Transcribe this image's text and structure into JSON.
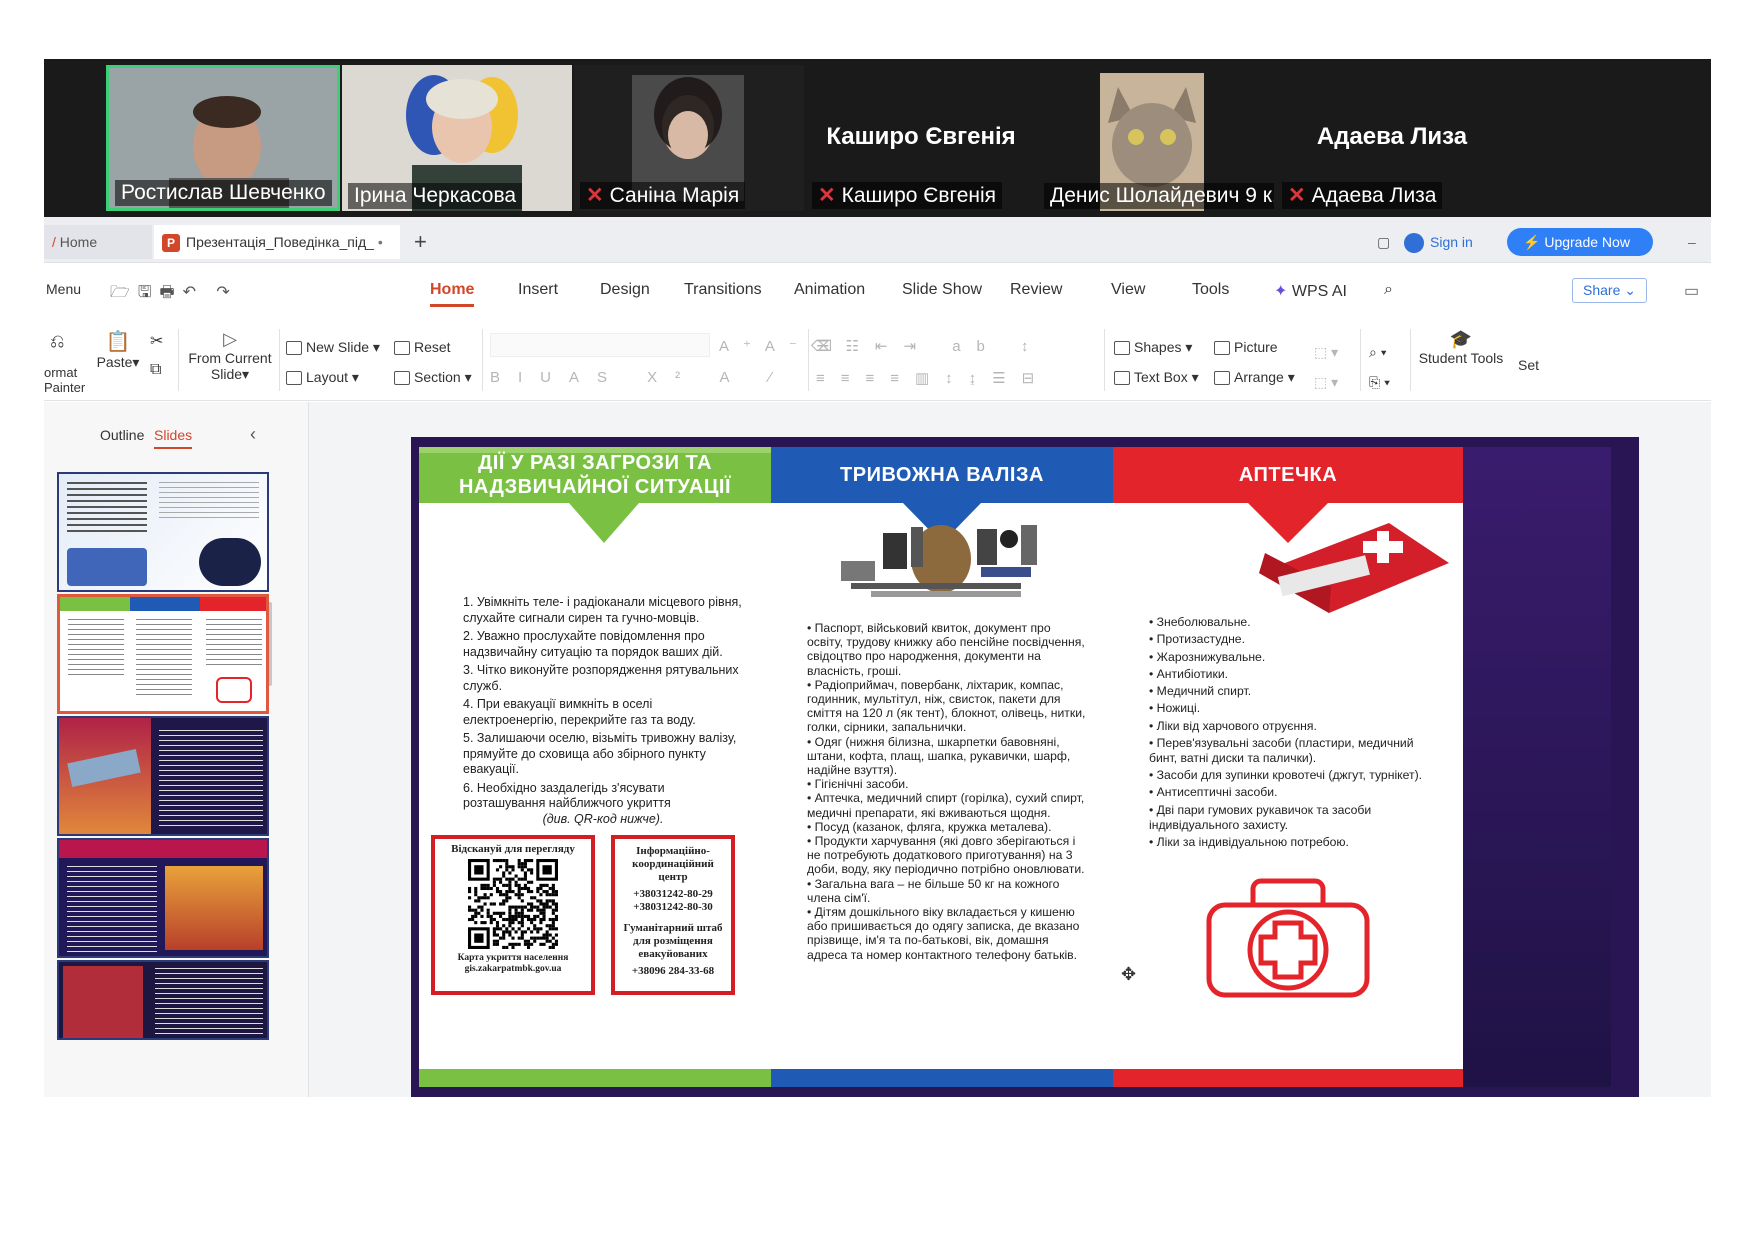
{
  "participants": [
    {
      "name": "Ростислав Шевченко",
      "muted": false,
      "video": true
    },
    {
      "name": "Ірина Черкасова",
      "muted": false,
      "video": true
    },
    {
      "name": "Саніна Марія",
      "muted": true,
      "video": true
    },
    {
      "name": "Каширо Євгенія",
      "muted": true,
      "video": false,
      "display": "Каширо Євгенія"
    },
    {
      "name": "Денис Шолайдевич 9 к...",
      "muted": false,
      "video": true
    },
    {
      "name": "Адаева Лиза",
      "muted": true,
      "video": false,
      "display": "Адаева Лиза"
    }
  ],
  "tabs": {
    "home": "Home",
    "doc": "Презентація_Поведінка_під_",
    "sign_in": "Sign in",
    "upgrade": "Upgrade Now"
  },
  "menu": {
    "menu": "Menu",
    "items": [
      "Home",
      "Insert",
      "Design",
      "Transitions",
      "Animation",
      "Slide Show",
      "Review",
      "View",
      "Tools",
      "WPS AI"
    ],
    "share": "Share"
  },
  "ribbon": {
    "format_painter": "ormat\nPainter",
    "paste": "Paste",
    "from_current": "From Current",
    "slide": "Slide",
    "new_slide": "New  Slide",
    "layout": "Layout",
    "reset": "Reset",
    "section": "Section",
    "shapes": "Shapes",
    "picture": "Picture",
    "text_box": "Text Box",
    "arrange": "Arrange",
    "student_tools": "Student Tools",
    "set": "Set"
  },
  "panel": {
    "outline": "Outline",
    "slides": "Slides"
  },
  "slide": {
    "col1": {
      "title": "ДІЇ У РАЗІ ЗАГРОЗИ ТА НАДЗВИЧАЙНОЇ СИТУАЦІЇ",
      "items": [
        "1. Увімкніть теле- і радіоканали місцевого рівня, слухайте сигнали сирен та гучно-мовців.",
        "2. Уважно прослухайте повідомлення про надзвичайну ситуацію та порядок ваших дій.",
        "3. Чітко виконуйте розпорядження рятувальних служб.",
        "4. При евакуації вимкніть в оселі електроенергію, перекрийте газ та воду.",
        "5. Залишаючи оселю, візьміть тривожну валізу, прямуйте до сховища або збірного пункту евакуації.",
        "6. Необхідно заздалегідь з'ясувати розташування найближчого укриття"
      ],
      "note": "(див. QR-код нижче).",
      "qr_top": "Відскануй для перегляду",
      "qr_bottom": "Карта укриття населення gis.zakarpatmbk.gov.ua",
      "info": [
        "Інформаційно-координаційний центр",
        "+38031242-80-29",
        "+38031242-80-30",
        "Гуманітарний штаб для розміщення евакуйованих",
        "+38096 284-33-68"
      ]
    },
    "col2": {
      "title": "ТРИВОЖНА ВАЛІЗА",
      "items": [
        "• Паспорт, військовий квиток, документ про освіту, трудову книжку або пенсійне посвідчення, свідоцтво про народження, документи на власність, гроші.",
        "• Радіоприймач, повербанк, ліхтарик, компас, годинник, мультітул, ніж, свисток, пакети для сміття на 120 л (як тент), блокнот, олівець, нитки, голки, сірники, запальнички.",
        "• Одяг (нижня білизна, шкарпетки бавовняні, штани, кофта, плащ, шапка, рукавички, шарф, надійне взуття).",
        "• Гігієнічні засоби.",
        "• Аптечка, медичний спирт (горілка), сухий спирт, медичні препарати, які вживаються щодня.",
        "• Посуд (казанок, фляга, кружка металева).",
        "• Продукти харчування (які довго зберігаються і не потребують додаткового приготування) на 3 доби, воду, яку періодично потрібно оновлювати.",
        "• Загальна вага – не більше 50 кг на кожного члена сім'ї.",
        "• Дітям дошкільного віку вкладається у кишеню або пришивається до одягу записка, де вказано прізвище, ім'я та по-батькові, вік, домашня адреса та номер контактного телефону батьків."
      ]
    },
    "col3": {
      "title": "АПТЕЧКА",
      "items": [
        "• Знеболювальне.",
        "• Протизастудне.",
        "• Жарознижувальне.",
        "• Антибіотики.",
        "• Медичний спирт.",
        "• Ножиці.",
        "• Ліки від харчового отруєння.",
        "• Перев'язувальні засоби (пластири, медичний бинт, ватні диски та палички).",
        "• Засоби для зупинки кровотечі (джгут, турнікет).",
        "• Антисептичні засоби.",
        "• Дві пари гумових рукавичок та засоби індивідуального захисту.",
        "• Ліки за індивідуальною потребою."
      ]
    }
  },
  "colors": {
    "green": "#7ac143",
    "blue": "#1f5bb5",
    "red": "#e3242b",
    "accent": "#d2462a",
    "upgrade": "#2f7ff7"
  }
}
